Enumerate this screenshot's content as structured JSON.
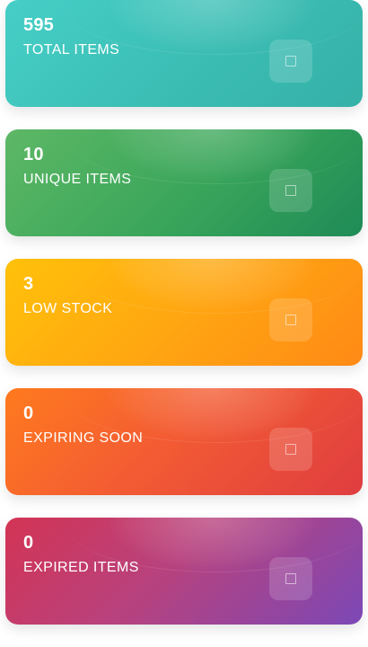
{
  "stats": [
    {
      "value": "595",
      "label": "TOTAL ITEMS",
      "icon": "box-icon",
      "color_from": "#46cfc7",
      "color_to": "#35b1a8"
    },
    {
      "value": "10",
      "label": "UNIQUE ITEMS",
      "icon": "box-icon",
      "color_from": "#5db866",
      "color_to": "#1f8b57"
    },
    {
      "value": "3",
      "label": "LOW STOCK",
      "icon": "box-icon",
      "color_from": "#ffc10a",
      "color_to": "#ff8a16"
    },
    {
      "value": "0",
      "label": "EXPIRING SOON",
      "icon": "box-icon",
      "color_from": "#ff7a1e",
      "color_to": "#df3d40"
    },
    {
      "value": "0",
      "label": "EXPIRED ITEMS",
      "icon": "box-icon",
      "color_from": "#d33454",
      "color_to": "#7c48b6"
    }
  ]
}
